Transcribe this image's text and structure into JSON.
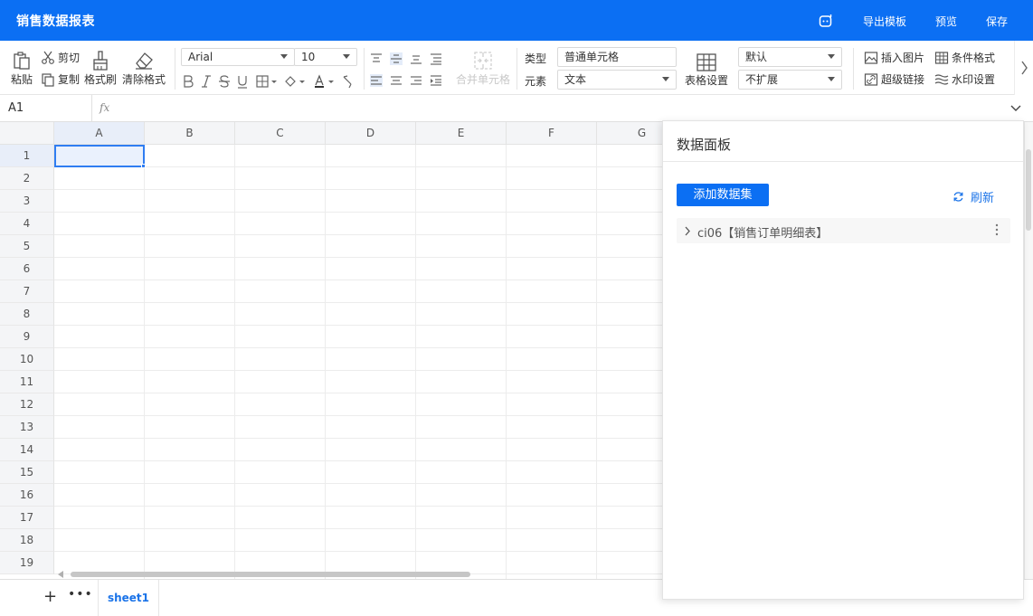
{
  "app": {
    "title": "销售数据报表"
  },
  "header": {
    "bot_icon": "robot-icon",
    "export": "导出模板",
    "preview": "预览",
    "save": "保存"
  },
  "toolbar": {
    "paste": "粘贴",
    "cut": "剪切",
    "copy": "复制",
    "format_painter": "格式刷",
    "clear_format": "清除格式",
    "font_family": "Arial",
    "font_size": "10",
    "merge_cells": "合并单元格",
    "type_label": "类型",
    "type_value": "普通单元格",
    "element_label": "元素",
    "element_value": "文本",
    "table_settings": "表格设置",
    "default_select": "默认",
    "expand_select": "不扩展",
    "insert_image": "插入图片",
    "conditional_format": "条件格式",
    "hyperlink": "超级链接",
    "watermark": "水印设置"
  },
  "formula": {
    "cell_ref": "A1",
    "fx": "fx"
  },
  "grid": {
    "columns": [
      "A",
      "B",
      "C",
      "D",
      "E",
      "F",
      "G"
    ],
    "rows": [
      "1",
      "2",
      "3",
      "4",
      "5",
      "6",
      "7",
      "8",
      "9",
      "10",
      "11",
      "12",
      "13",
      "14",
      "15",
      "16",
      "17",
      "18",
      "19"
    ]
  },
  "sheets": {
    "add": "+",
    "more": "•••",
    "tabs": [
      "sheet1"
    ]
  },
  "panel": {
    "title": "数据面板",
    "add_dataset": "添加数据集",
    "refresh": "刷新",
    "datasets": [
      "ci06【销售订单明细表】"
    ]
  },
  "colors": {
    "brand": "#0b6ff3",
    "selection": "#2f7df2"
  }
}
